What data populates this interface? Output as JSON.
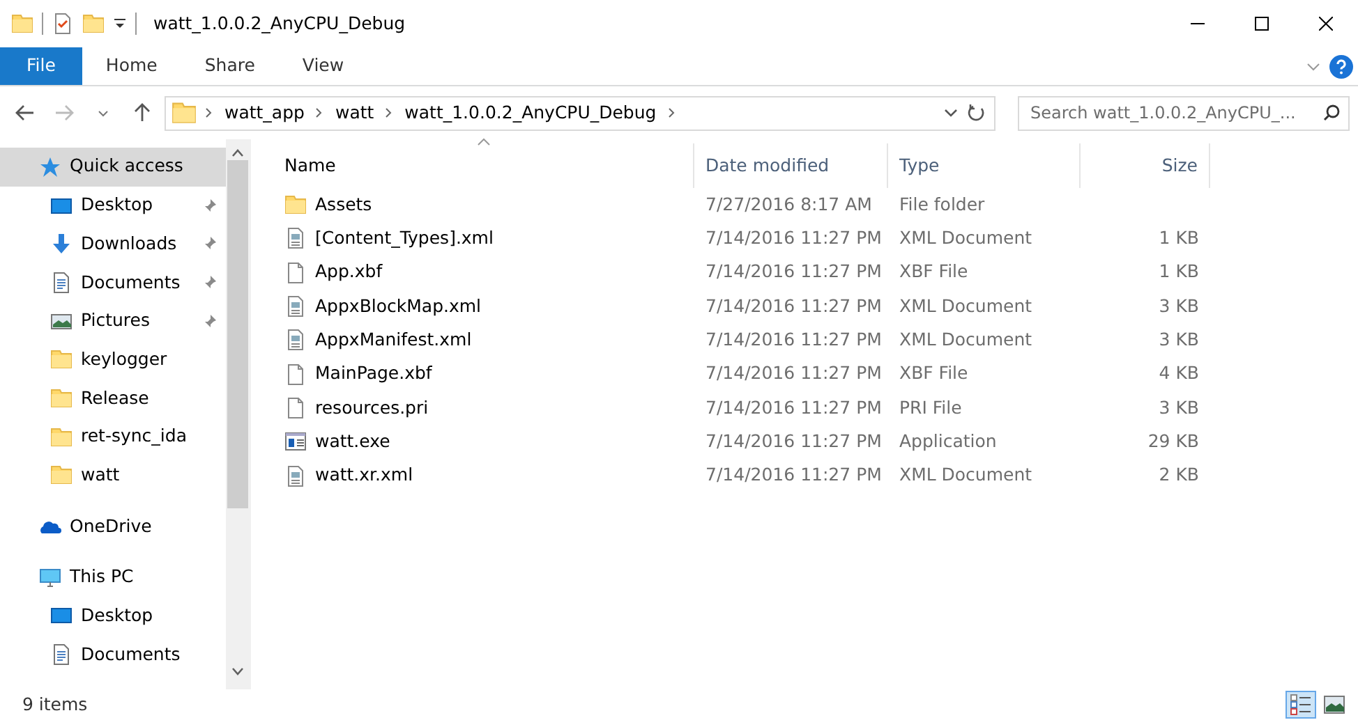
{
  "window": {
    "title": "watt_1.0.0.2_AnyCPU_Debug"
  },
  "ribbon_tabs": [
    {
      "label": "File",
      "kind": "file"
    },
    {
      "label": "Home",
      "kind": "tab"
    },
    {
      "label": "Share",
      "kind": "tab"
    },
    {
      "label": "View",
      "kind": "tab"
    }
  ],
  "address_bar": {
    "path": [
      "watt_app",
      "watt",
      "watt_1.0.0.2_AnyCPU_Debug"
    ]
  },
  "search": {
    "placeholder": "Search watt_1.0.0.2_AnyCPU_..."
  },
  "sidebar": {
    "items": [
      {
        "label": "Quick access",
        "kind": "star",
        "selected": true,
        "pinned": false,
        "children": [
          {
            "label": "Desktop",
            "kind": "desktop",
            "selected": false,
            "pinned": true
          },
          {
            "label": "Downloads",
            "kind": "download",
            "selected": false,
            "pinned": true
          },
          {
            "label": "Documents",
            "kind": "document",
            "selected": false,
            "pinned": true
          },
          {
            "label": "Pictures",
            "kind": "pictures",
            "selected": false,
            "pinned": true
          },
          {
            "label": "keylogger",
            "kind": "folder",
            "selected": false,
            "pinned": false
          },
          {
            "label": "Release",
            "kind": "folder",
            "selected": false,
            "pinned": false
          },
          {
            "label": "ret-sync_ida",
            "kind": "folder",
            "selected": false,
            "pinned": false
          },
          {
            "label": "watt",
            "kind": "folder",
            "selected": false,
            "pinned": false
          }
        ]
      },
      {
        "label": "OneDrive",
        "kind": "cloud",
        "selected": false,
        "pinned": false
      },
      {
        "label": "This PC",
        "kind": "pc",
        "selected": false,
        "pinned": false,
        "children": [
          {
            "label": "Desktop",
            "kind": "desktop",
            "selected": false,
            "pinned": false
          },
          {
            "label": "Documents",
            "kind": "document",
            "selected": false,
            "pinned": false
          }
        ]
      }
    ]
  },
  "table": {
    "columns": [
      {
        "label": "Name",
        "sorted": true
      },
      {
        "label": "Date modified",
        "sorted": false
      },
      {
        "label": "Type",
        "sorted": false
      },
      {
        "label": "Size",
        "sorted": false
      }
    ],
    "rows": [
      {
        "kind": "folder",
        "name": "Assets",
        "date": "7/27/2016 8:17 AM",
        "type": "File folder"
      },
      {
        "kind": "xml",
        "name": "[Content_Types].xml",
        "date": "7/14/2016 11:27 PM",
        "type": "XML Document",
        "size": "1 KB"
      },
      {
        "kind": "blank",
        "name": "App.xbf",
        "date": "7/14/2016 11:27 PM",
        "type": "XBF File",
        "size": "1 KB"
      },
      {
        "kind": "xml",
        "name": "AppxBlockMap.xml",
        "date": "7/14/2016 11:27 PM",
        "type": "XML Document",
        "size": "3 KB"
      },
      {
        "kind": "xml",
        "name": "AppxManifest.xml",
        "date": "7/14/2016 11:27 PM",
        "type": "XML Document",
        "size": "3 KB"
      },
      {
        "kind": "blank",
        "name": "MainPage.xbf",
        "date": "7/14/2016 11:27 PM",
        "type": "XBF File",
        "size": "4 KB"
      },
      {
        "kind": "blank",
        "name": "resources.pri",
        "date": "7/14/2016 11:27 PM",
        "type": "PRI File",
        "size": "3 KB"
      },
      {
        "kind": "exe",
        "name": "watt.exe",
        "date": "7/14/2016 11:27 PM",
        "type": "Application",
        "size": "29 KB"
      },
      {
        "kind": "xml",
        "name": "watt.xr.xml",
        "date": "7/14/2016 11:27 PM",
        "type": "XML Document",
        "size": "2 KB"
      }
    ]
  },
  "status_bar": {
    "text": "9 items",
    "view_modes": [
      {
        "kind": "details",
        "selected": true
      },
      {
        "kind": "thumbnails",
        "selected": false
      }
    ]
  }
}
